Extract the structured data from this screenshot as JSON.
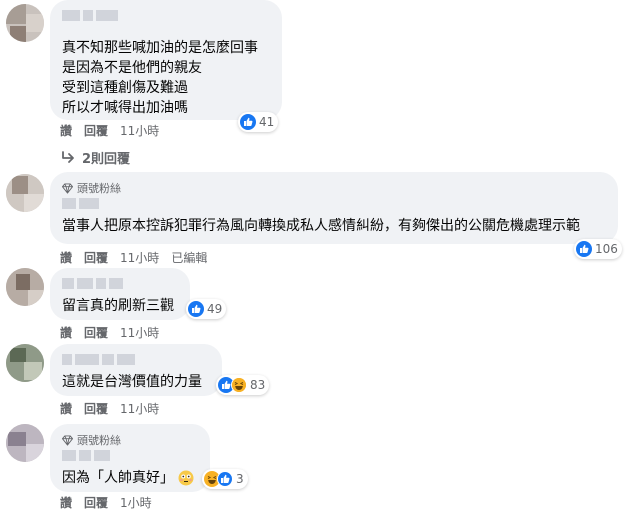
{
  "comments": [
    {
      "lines": "真不知那些喊加油的是怎麼回事\n是因為不是他們的親友\n受到這種創傷及難過\n所以才喊得出加油嗎",
      "reaction_count": "41",
      "actions": {
        "like": "讚",
        "reply": "回覆",
        "time": "11小時"
      },
      "view_replies": "2則回覆"
    },
    {
      "badge": "頭號粉絲",
      "lines": "當事人把原本控訴犯罪行為風向轉換成私人感情糾紛，有夠傑出的公關危機處理示範",
      "reaction_count": "106",
      "actions": {
        "like": "讚",
        "reply": "回覆",
        "time": "11小時",
        "edited": "已編輯"
      }
    },
    {
      "lines": "留言真的刷新三觀",
      "reaction_count": "49",
      "actions": {
        "like": "讚",
        "reply": "回覆",
        "time": "11小時"
      }
    },
    {
      "lines": "這就是台灣價值的力量",
      "reaction_count": "83",
      "actions": {
        "like": "讚",
        "reply": "回覆",
        "time": "11小時"
      }
    },
    {
      "badge": "頭號粉絲",
      "lines": "因為「人帥真好」",
      "reaction_count": "3",
      "actions": {
        "like": "讚",
        "reply": "回覆",
        "time": "1小時"
      }
    }
  ],
  "icons": {
    "reaction_like": "thumbs-up-icon",
    "reaction_haha": "laughing-face-icon",
    "badge": "diamond-icon",
    "reply_arrow": "reply-arrow-icon",
    "inline_emoji": "flushed-face-icon"
  },
  "colors": {
    "like_blue": "#1877f2",
    "haha_yellow": "#f7b125",
    "bubble_bg": "#f0f2f5",
    "meta_gray": "#65676b"
  }
}
